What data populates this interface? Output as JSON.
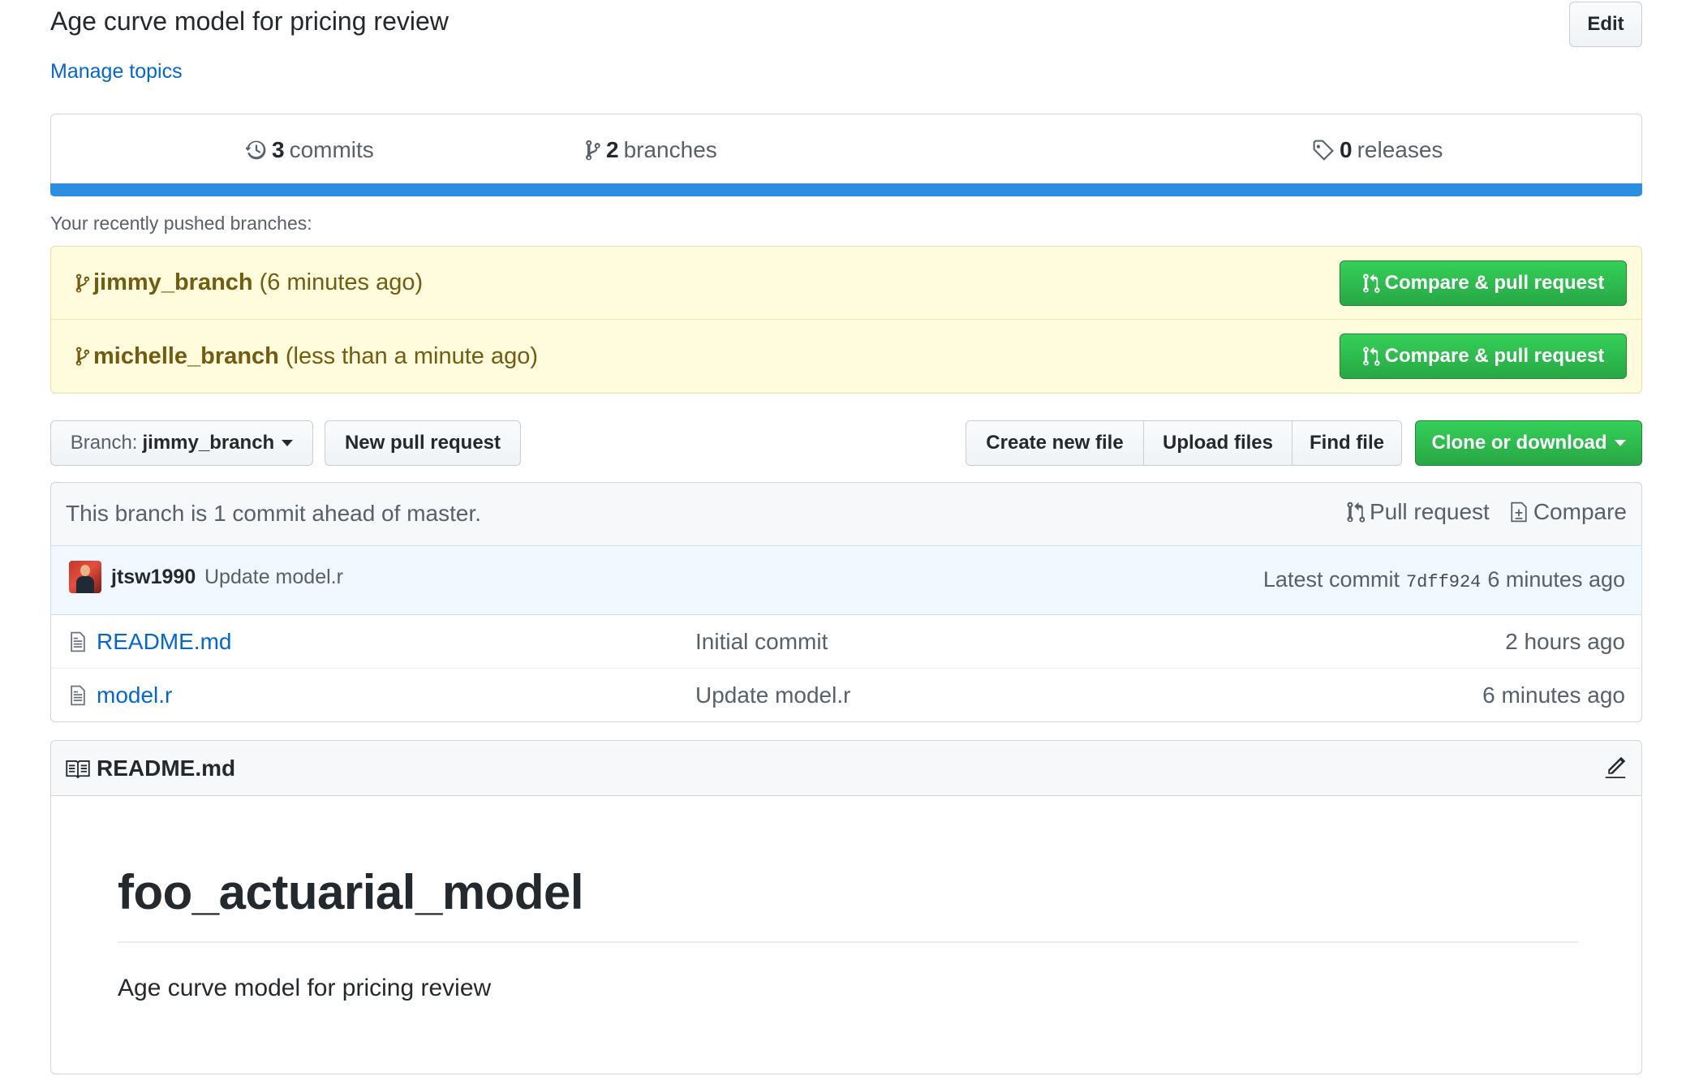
{
  "repo": {
    "description": "Age curve model for pricing review",
    "manage_topics": "Manage topics",
    "edit_label": "Edit"
  },
  "summary": {
    "commits_count": "3",
    "commits_label": "commits",
    "branches_count": "2",
    "branches_label": "branches",
    "releases_count": "0",
    "releases_label": "releases",
    "language_color": "#2b8ee0"
  },
  "recent": {
    "label": "Your recently pushed branches:",
    "branches": [
      {
        "name": "jimmy_branch",
        "time": "(6 minutes ago)",
        "button": "Compare & pull request"
      },
      {
        "name": "michelle_branch",
        "time": "(less than a minute ago)",
        "button": "Compare & pull request"
      }
    ]
  },
  "file_nav": {
    "branch_prefix": "Branch:",
    "branch_name": "jimmy_branch",
    "new_pull_request": "New pull request",
    "create_new_file": "Create new file",
    "upload_files": "Upload files",
    "find_file": "Find file",
    "clone_or_download": "Clone or download"
  },
  "branch_info": {
    "text": "This branch is 1 commit ahead of master.",
    "pull_request": "Pull request",
    "compare": "Compare"
  },
  "commit": {
    "author": "jtsw1990",
    "message": "Update model.r",
    "latest_label": "Latest commit",
    "sha": "7dff924",
    "age": "6 minutes ago"
  },
  "files": [
    {
      "name": "README.md",
      "message": "Initial commit",
      "age": "2 hours ago",
      "icon": "file-icon"
    },
    {
      "name": "model.r",
      "message": "Update model.r",
      "age": "6 minutes ago",
      "icon": "file-icon"
    }
  ],
  "readme": {
    "filename": "README.md",
    "heading": "foo_actuarial_model",
    "paragraph": "Age curve model for pricing review"
  },
  "colors": {
    "link": "#0366d6",
    "green": "#28a745",
    "recent_bg": "#fffbdd"
  }
}
